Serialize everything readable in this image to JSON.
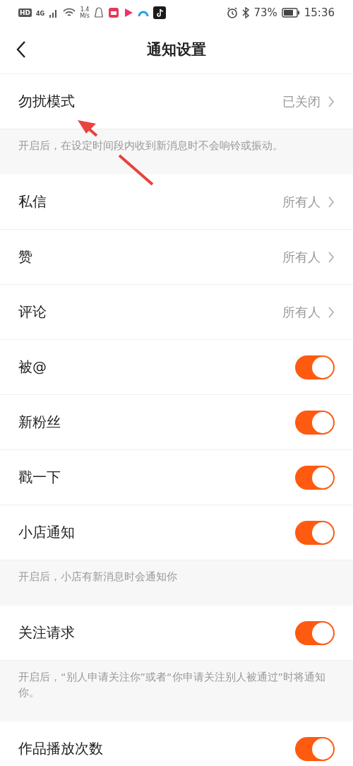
{
  "status_bar": {
    "hd": "HD",
    "network": "4G",
    "speed_value": "1.4",
    "speed_unit": "M/s",
    "battery": "73%",
    "time": "15:36"
  },
  "header": {
    "title": "通知设置"
  },
  "items": [
    {
      "kind": "value",
      "label": "勿扰模式",
      "value": "已关闭"
    },
    {
      "kind": "note",
      "text": "开启后，在设定时间段内收到新消息时不会响铃或振动。"
    },
    {
      "kind": "value",
      "label": "私信",
      "value": "所有人"
    },
    {
      "kind": "value",
      "label": "赞",
      "value": "所有人"
    },
    {
      "kind": "value",
      "label": "评论",
      "value": "所有人"
    },
    {
      "kind": "toggle",
      "label": "被@",
      "on": true
    },
    {
      "kind": "toggle",
      "label": "新粉丝",
      "on": true
    },
    {
      "kind": "toggle",
      "label": "戳一下",
      "on": true
    },
    {
      "kind": "toggle",
      "label": "小店通知",
      "on": true
    },
    {
      "kind": "note",
      "text": "开启后，小店有新消息时会通知你"
    },
    {
      "kind": "toggle",
      "label": "关注请求",
      "on": true
    },
    {
      "kind": "note",
      "text": "开启后，“别人申请关注你”或者“你申请关注别人被通过”时将通知你。"
    },
    {
      "kind": "toggle",
      "label": "作品播放次数",
      "on": true
    }
  ]
}
